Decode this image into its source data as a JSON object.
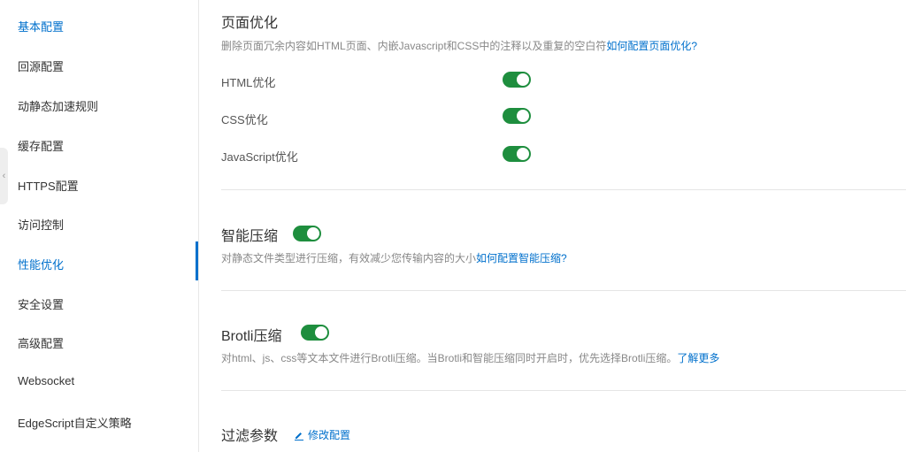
{
  "sidebar": {
    "items": [
      {
        "label": "基本配置"
      },
      {
        "label": "回源配置"
      },
      {
        "label": "动静态加速规则"
      },
      {
        "label": "缓存配置"
      },
      {
        "label": "HTTPS配置"
      },
      {
        "label": "访问控制"
      },
      {
        "label": "性能优化"
      },
      {
        "label": "安全设置"
      },
      {
        "label": "高级配置"
      },
      {
        "label": "Websocket"
      },
      {
        "label": "EdgeScript自定义策略"
      }
    ],
    "active_item": "性能优化",
    "collapse_glyph": "‹"
  },
  "page_optimize": {
    "title": "页面优化",
    "desc": "删除页面冗余内容如HTML页面、内嵌Javascript和CSS中的注释以及重复的空白符",
    "link": "如何配置页面优化?",
    "options": [
      {
        "label": "HTML优化",
        "enabled": true
      },
      {
        "label": "CSS优化",
        "enabled": true
      },
      {
        "label": "JavaScript优化",
        "enabled": true
      }
    ]
  },
  "smart_compress": {
    "title": "智能压缩",
    "enabled": true,
    "desc": "对静态文件类型进行压缩，有效减少您传输内容的大小",
    "link": "如何配置智能压缩?"
  },
  "brotli": {
    "title": "Brotli压缩",
    "enabled": true,
    "desc": "对html、js、css等文本文件进行Brotli压缩。当Brotli和智能压缩同时开启时，优先选择Brotli压缩。",
    "link": "了解更多"
  },
  "filter_params": {
    "title": "过滤参数",
    "edit_label": "修改配置"
  },
  "colors": {
    "accent": "#0070cc",
    "toggle_on": "#1e8e3e"
  }
}
